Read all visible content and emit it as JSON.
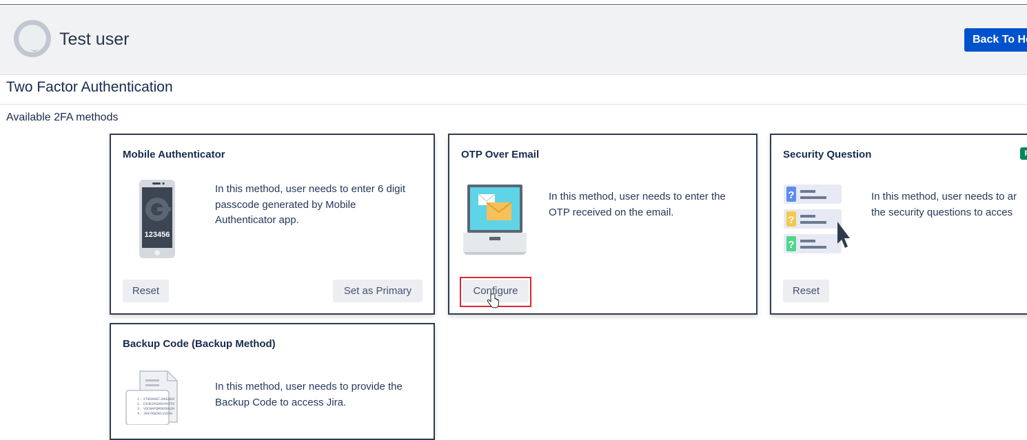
{
  "header": {
    "user_name": "Test user",
    "back_button": "Back To He"
  },
  "page": {
    "title": "Two Factor Authentication",
    "section_label": "Available 2FA methods"
  },
  "methods": [
    {
      "title": "Mobile Authenticator",
      "description": "In this method, user needs to enter 6 digit passcode generated by Mobile Authenticator app.",
      "illustration_code": "123456",
      "buttons": [
        "Reset",
        "Set as Primary"
      ]
    },
    {
      "title": "OTP Over Email",
      "description": "In this method, user needs to enter the OTP received on the email.",
      "buttons": [
        "Configure"
      ]
    },
    {
      "title": "Security Question",
      "description": "In this method, user needs to ar the security questions to acces",
      "badge": "P",
      "buttons": [
        "Reset"
      ]
    },
    {
      "title": "Backup Code (Backup Method)",
      "description": "In this method, user needs to provide the Backup Code to access Jira.",
      "codes": [
        "1. XTWXKKB7J6KEBU4",
        "2. DIGEZKGH6X4XOT9",
        "3. VOCNAPQM6KOGG2H",
        "4. 3997KBZW11S5VG"
      ]
    }
  ],
  "colors": {
    "accent": "#0052cc",
    "highlight": "#d9262f",
    "card_border": "#2f3b4d"
  }
}
